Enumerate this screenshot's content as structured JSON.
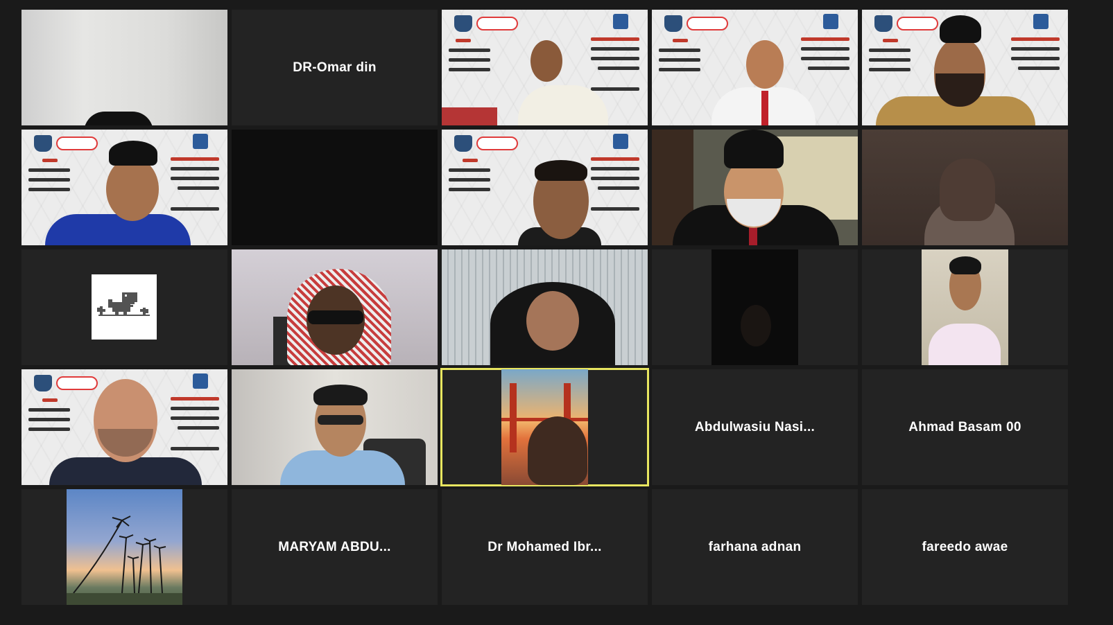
{
  "meeting": {
    "layout": "gallery-view",
    "active_speaker_color": "#e8e660",
    "tiles": [
      {
        "id": "t1",
        "type": "video"
      },
      {
        "id": "t2",
        "type": "name",
        "name": "DR-Omar din"
      },
      {
        "id": "t3",
        "type": "video"
      },
      {
        "id": "t4",
        "type": "video"
      },
      {
        "id": "t5",
        "type": "video"
      },
      {
        "id": "t6",
        "type": "video"
      },
      {
        "id": "t7",
        "type": "blank"
      },
      {
        "id": "t8",
        "type": "video"
      },
      {
        "id": "t9",
        "type": "video"
      },
      {
        "id": "t10",
        "type": "video"
      },
      {
        "id": "t11",
        "type": "avatar",
        "icon": "dino-icon"
      },
      {
        "id": "t12",
        "type": "video"
      },
      {
        "id": "t13",
        "type": "video"
      },
      {
        "id": "t14",
        "type": "video"
      },
      {
        "id": "t15",
        "type": "video"
      },
      {
        "id": "t16",
        "type": "video"
      },
      {
        "id": "t17",
        "type": "video"
      },
      {
        "id": "t18",
        "type": "video",
        "active": true
      },
      {
        "id": "t19",
        "type": "name",
        "name": "Abdulwasiu  Nasi..."
      },
      {
        "id": "t20",
        "type": "name",
        "name": "Ahmad Basam 00"
      },
      {
        "id": "t21",
        "type": "avatar-image"
      },
      {
        "id": "t22",
        "type": "name",
        "name": "MARYAM  ABDU..."
      },
      {
        "id": "t23",
        "type": "name",
        "name": "Dr  Mohamed  Ibr..."
      },
      {
        "id": "t24",
        "type": "name",
        "name": "farhana adnan"
      },
      {
        "id": "t25",
        "type": "name",
        "name": "fareedo awae"
      }
    ]
  }
}
